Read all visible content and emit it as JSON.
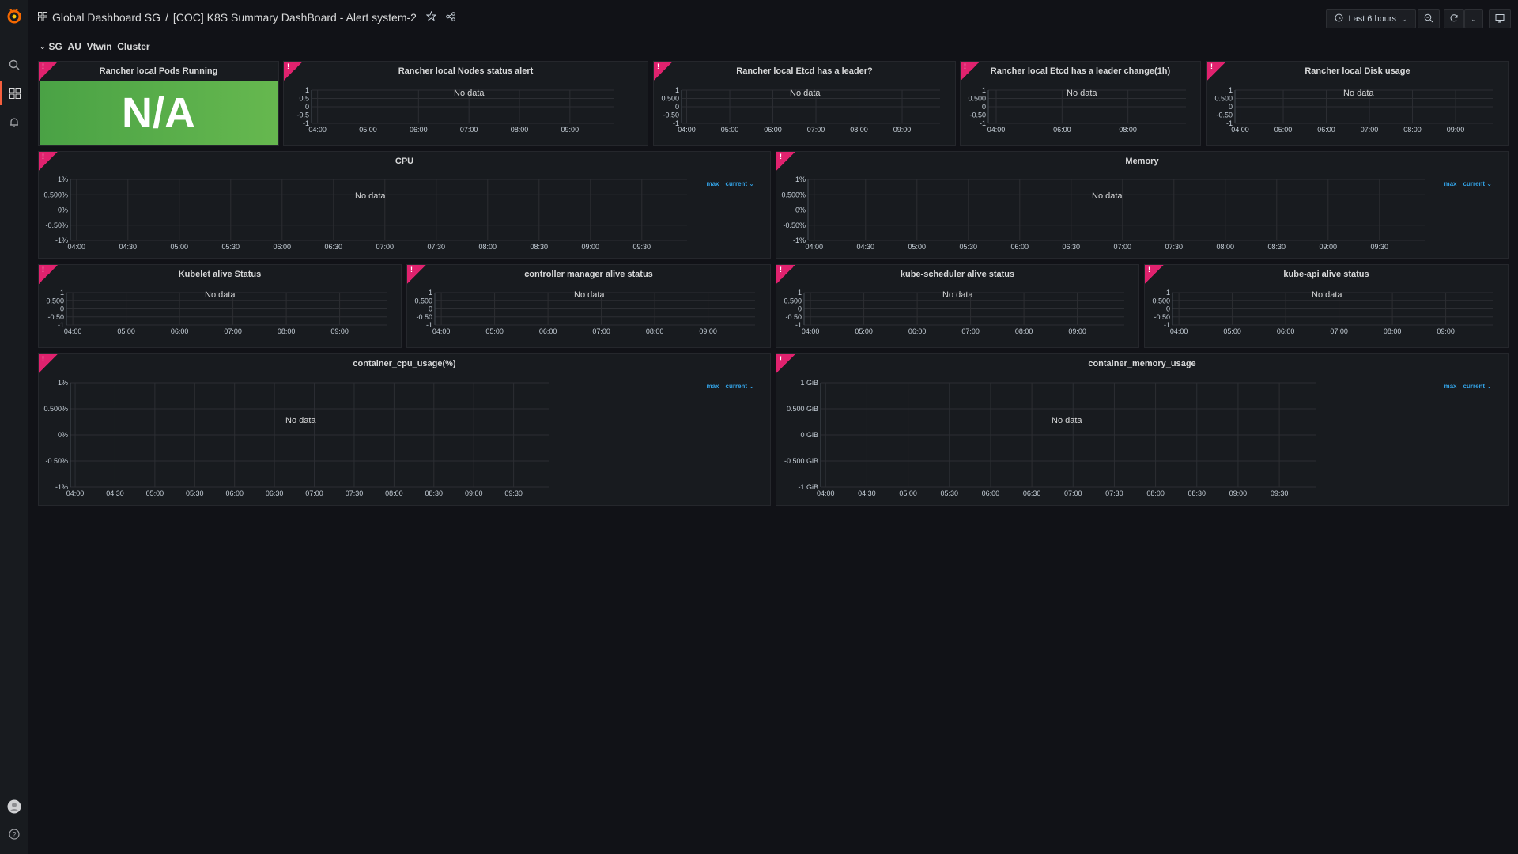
{
  "breadcrumb": {
    "folder": "Global Dashboard SG",
    "separator": "/",
    "title": "[COC] K8S Summary DashBoard - Alert system-2"
  },
  "toolbar": {
    "time_range": "Last 6 hours"
  },
  "row": {
    "title": "SG_AU_Vtwin_Cluster"
  },
  "panels": {
    "pods_running": {
      "title": "Rancher local Pods Running",
      "value": "N/A",
      "alert": "!"
    },
    "nodes_status": {
      "title": "Rancher local Nodes status alert",
      "no_data": "No data",
      "alert": "!",
      "y_ticks": [
        "1",
        "0.5",
        "0",
        "-0.5",
        "-1"
      ],
      "x_ticks": [
        "04:00",
        "05:00",
        "06:00",
        "07:00",
        "08:00",
        "09:00"
      ]
    },
    "etcd_leader": {
      "title": "Rancher local Etcd has a leader?",
      "no_data": "No data",
      "alert": "!",
      "y_ticks": [
        "1",
        "0.500",
        "0",
        "-0.50",
        "-1"
      ],
      "x_ticks": [
        "04:00",
        "05:00",
        "06:00",
        "07:00",
        "08:00",
        "09:00"
      ]
    },
    "etcd_leader_change": {
      "title": "Rancher local Etcd has a leader change(1h)",
      "no_data": "No data",
      "alert": "!",
      "y_ticks": [
        "1",
        "0.500",
        "0",
        "-0.50",
        "-1"
      ],
      "x_ticks": [
        "04:00",
        "06:00",
        "08:00"
      ]
    },
    "disk_usage": {
      "title": "Rancher local Disk usage",
      "no_data": "No data",
      "alert": "!",
      "y_ticks": [
        "1",
        "0.500",
        "0",
        "-0.50",
        "-1"
      ],
      "x_ticks": [
        "04:00",
        "05:00",
        "06:00",
        "07:00",
        "08:00",
        "09:00"
      ]
    },
    "cpu": {
      "title": "CPU",
      "no_data": "No data",
      "alert": "!",
      "legend_max": "max",
      "legend_current": "current ⌄",
      "y_ticks": [
        "1%",
        "0.500%",
        "0%",
        "-0.50%",
        "-1%"
      ],
      "x_ticks": [
        "04:00",
        "04:30",
        "05:00",
        "05:30",
        "06:00",
        "06:30",
        "07:00",
        "07:30",
        "08:00",
        "08:30",
        "09:00",
        "09:30"
      ]
    },
    "memory": {
      "title": "Memory",
      "no_data": "No data",
      "alert": "!",
      "legend_max": "max",
      "legend_current": "current ⌄",
      "y_ticks": [
        "1%",
        "0.500%",
        "0%",
        "-0.50%",
        "-1%"
      ],
      "x_ticks": [
        "04:00",
        "04:30",
        "05:00",
        "05:30",
        "06:00",
        "06:30",
        "07:00",
        "07:30",
        "08:00",
        "08:30",
        "09:00",
        "09:30"
      ]
    },
    "kubelet": {
      "title": "Kubelet alive Status",
      "no_data": "No data",
      "alert": "!",
      "y_ticks": [
        "1",
        "0.500",
        "0",
        "-0.50",
        "-1"
      ],
      "x_ticks": [
        "04:00",
        "05:00",
        "06:00",
        "07:00",
        "08:00",
        "09:00"
      ]
    },
    "controller_manager": {
      "title": "controller manager alive status",
      "no_data": "No data",
      "alert": "!",
      "y_ticks": [
        "1",
        "0.500",
        "0",
        "-0.50",
        "-1"
      ],
      "x_ticks": [
        "04:00",
        "05:00",
        "06:00",
        "07:00",
        "08:00",
        "09:00"
      ]
    },
    "kube_scheduler": {
      "title": "kube-scheduler alive status",
      "no_data": "No data",
      "alert": "!",
      "y_ticks": [
        "1",
        "0.500",
        "0",
        "-0.50",
        "-1"
      ],
      "x_ticks": [
        "04:00",
        "05:00",
        "06:00",
        "07:00",
        "08:00",
        "09:00"
      ]
    },
    "kube_api": {
      "title": "kube-api alive status",
      "no_data": "No data",
      "alert": "!",
      "y_ticks": [
        "1",
        "0.500",
        "0",
        "-0.50",
        "-1"
      ],
      "x_ticks": [
        "04:00",
        "05:00",
        "06:00",
        "07:00",
        "08:00",
        "09:00"
      ]
    },
    "container_cpu": {
      "title": "container_cpu_usage(%)",
      "no_data": "No data",
      "alert": "!",
      "legend_max": "max",
      "legend_current": "current ⌄",
      "y_ticks": [
        "1%",
        "0.500%",
        "0%",
        "-0.50%",
        "-1%"
      ],
      "x_ticks": [
        "04:00",
        "04:30",
        "05:00",
        "05:30",
        "06:00",
        "06:30",
        "07:00",
        "07:30",
        "08:00",
        "08:30",
        "09:00",
        "09:30"
      ]
    },
    "container_memory": {
      "title": "container_memory_usage",
      "no_data": "No data",
      "alert": "!",
      "legend_max": "max",
      "legend_current": "current ⌄",
      "y_ticks": [
        "1 GiB",
        "0.500 GiB",
        "0 GiB",
        "-0.500 GiB",
        "-1 GiB"
      ],
      "x_ticks": [
        "04:00",
        "04:30",
        "05:00",
        "05:30",
        "06:00",
        "06:30",
        "07:00",
        "07:30",
        "08:00",
        "08:30",
        "09:00",
        "09:30"
      ]
    }
  },
  "colors": {
    "alert": "#e0226e",
    "stat_ok": "#53a24a",
    "legend": "#33a2e5",
    "brand": "#f55f3e"
  },
  "icons": [
    "grafana-logo-icon",
    "search-icon",
    "dashboards-icon",
    "alerting-bell-icon",
    "user-avatar-icon",
    "help-icon",
    "star-icon",
    "share-icon",
    "clock-icon",
    "zoom-out-icon",
    "refresh-icon",
    "tv-mode-icon"
  ]
}
